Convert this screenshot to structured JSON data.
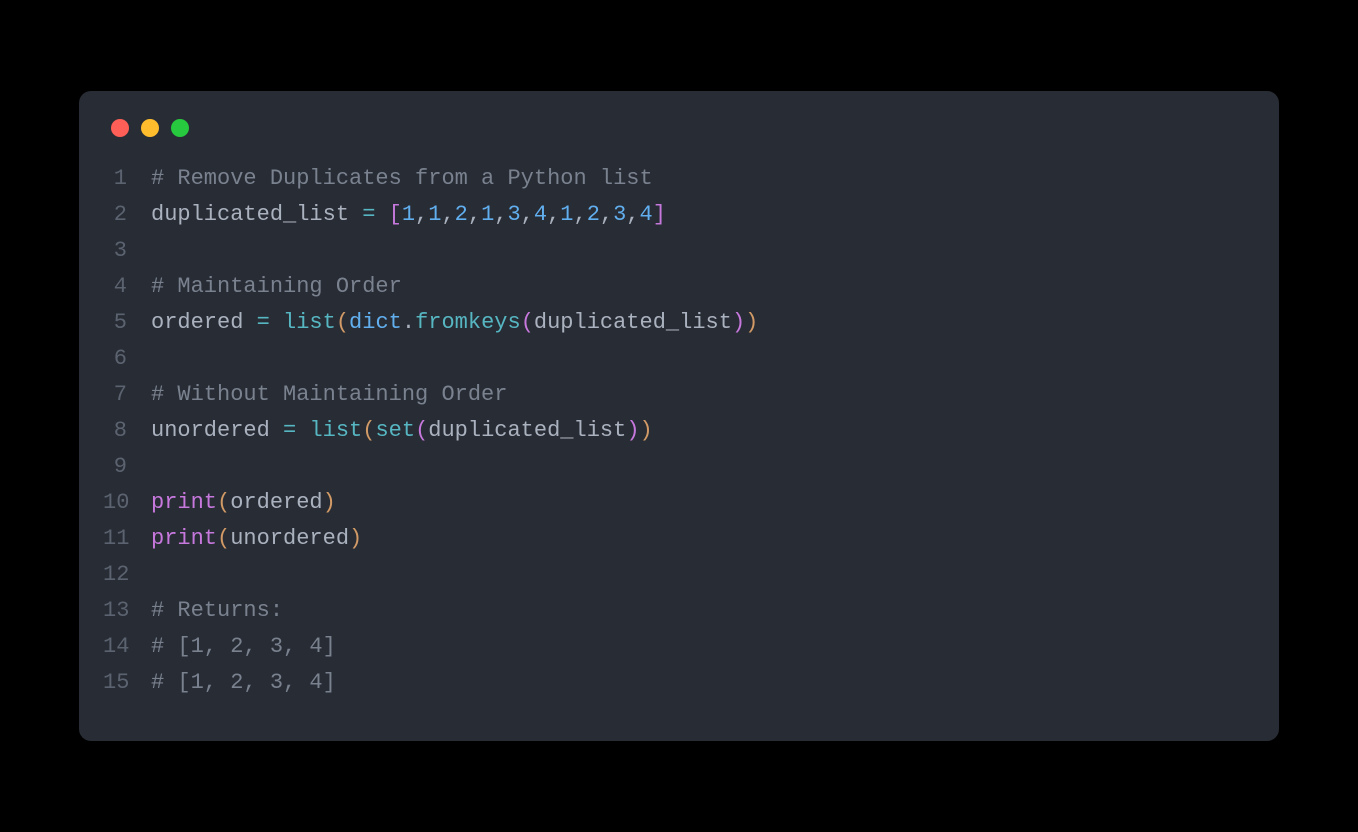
{
  "window": {
    "controls": {
      "close": "close",
      "minimize": "minimize",
      "maximize": "maximize"
    }
  },
  "code": {
    "lines": [
      {
        "n": "1"
      },
      {
        "n": "2"
      },
      {
        "n": "3"
      },
      {
        "n": "4"
      },
      {
        "n": "5"
      },
      {
        "n": "6"
      },
      {
        "n": "7"
      },
      {
        "n": "8"
      },
      {
        "n": "9"
      },
      {
        "n": "10"
      },
      {
        "n": "11"
      },
      {
        "n": "12"
      },
      {
        "n": "13"
      },
      {
        "n": "14"
      },
      {
        "n": "15"
      }
    ],
    "tokens": {
      "l1_comment": "# Remove Duplicates from a Python list",
      "l2_var": "duplicated_list ",
      "l2_eq": "=",
      "l2_sp": " ",
      "l2_lb": "[",
      "l2_n1": "1",
      "l2_c1": ",",
      "l2_n2": "1",
      "l2_c2": ",",
      "l2_n3": "2",
      "l2_c3": ",",
      "l2_n4": "1",
      "l2_c4": ",",
      "l2_n5": "3",
      "l2_c5": ",",
      "l2_n6": "4",
      "l2_c6": ",",
      "l2_n7": "1",
      "l2_c7": ",",
      "l2_n8": "2",
      "l2_c8": ",",
      "l2_n9": "3",
      "l2_c9": ",",
      "l2_n10": "4",
      "l2_rb": "]",
      "l4_comment": "# Maintaining Order",
      "l5_var": "ordered ",
      "l5_eq": "=",
      "l5_sp": " ",
      "l5_list": "list",
      "l5_lp1": "(",
      "l5_dict": "dict",
      "l5_dot": ".",
      "l5_fromkeys": "fromkeys",
      "l5_lp2": "(",
      "l5_arg": "duplicated_list",
      "l5_rp2": ")",
      "l5_rp1": ")",
      "l7_comment": "# Without Maintaining Order",
      "l8_var": "unordered ",
      "l8_eq": "=",
      "l8_sp": " ",
      "l8_list": "list",
      "l8_lp1": "(",
      "l8_set": "set",
      "l8_lp2": "(",
      "l8_arg": "duplicated_list",
      "l8_rp2": ")",
      "l8_rp1": ")",
      "l10_print": "print",
      "l10_lp": "(",
      "l10_arg": "ordered",
      "l10_rp": ")",
      "l11_print": "print",
      "l11_lp": "(",
      "l11_arg": "unordered",
      "l11_rp": ")",
      "l13_comment": "# Returns:",
      "l14_comment": "# [1, 2, 3, 4]",
      "l15_comment": "# [1, 2, 3, 4]"
    }
  }
}
